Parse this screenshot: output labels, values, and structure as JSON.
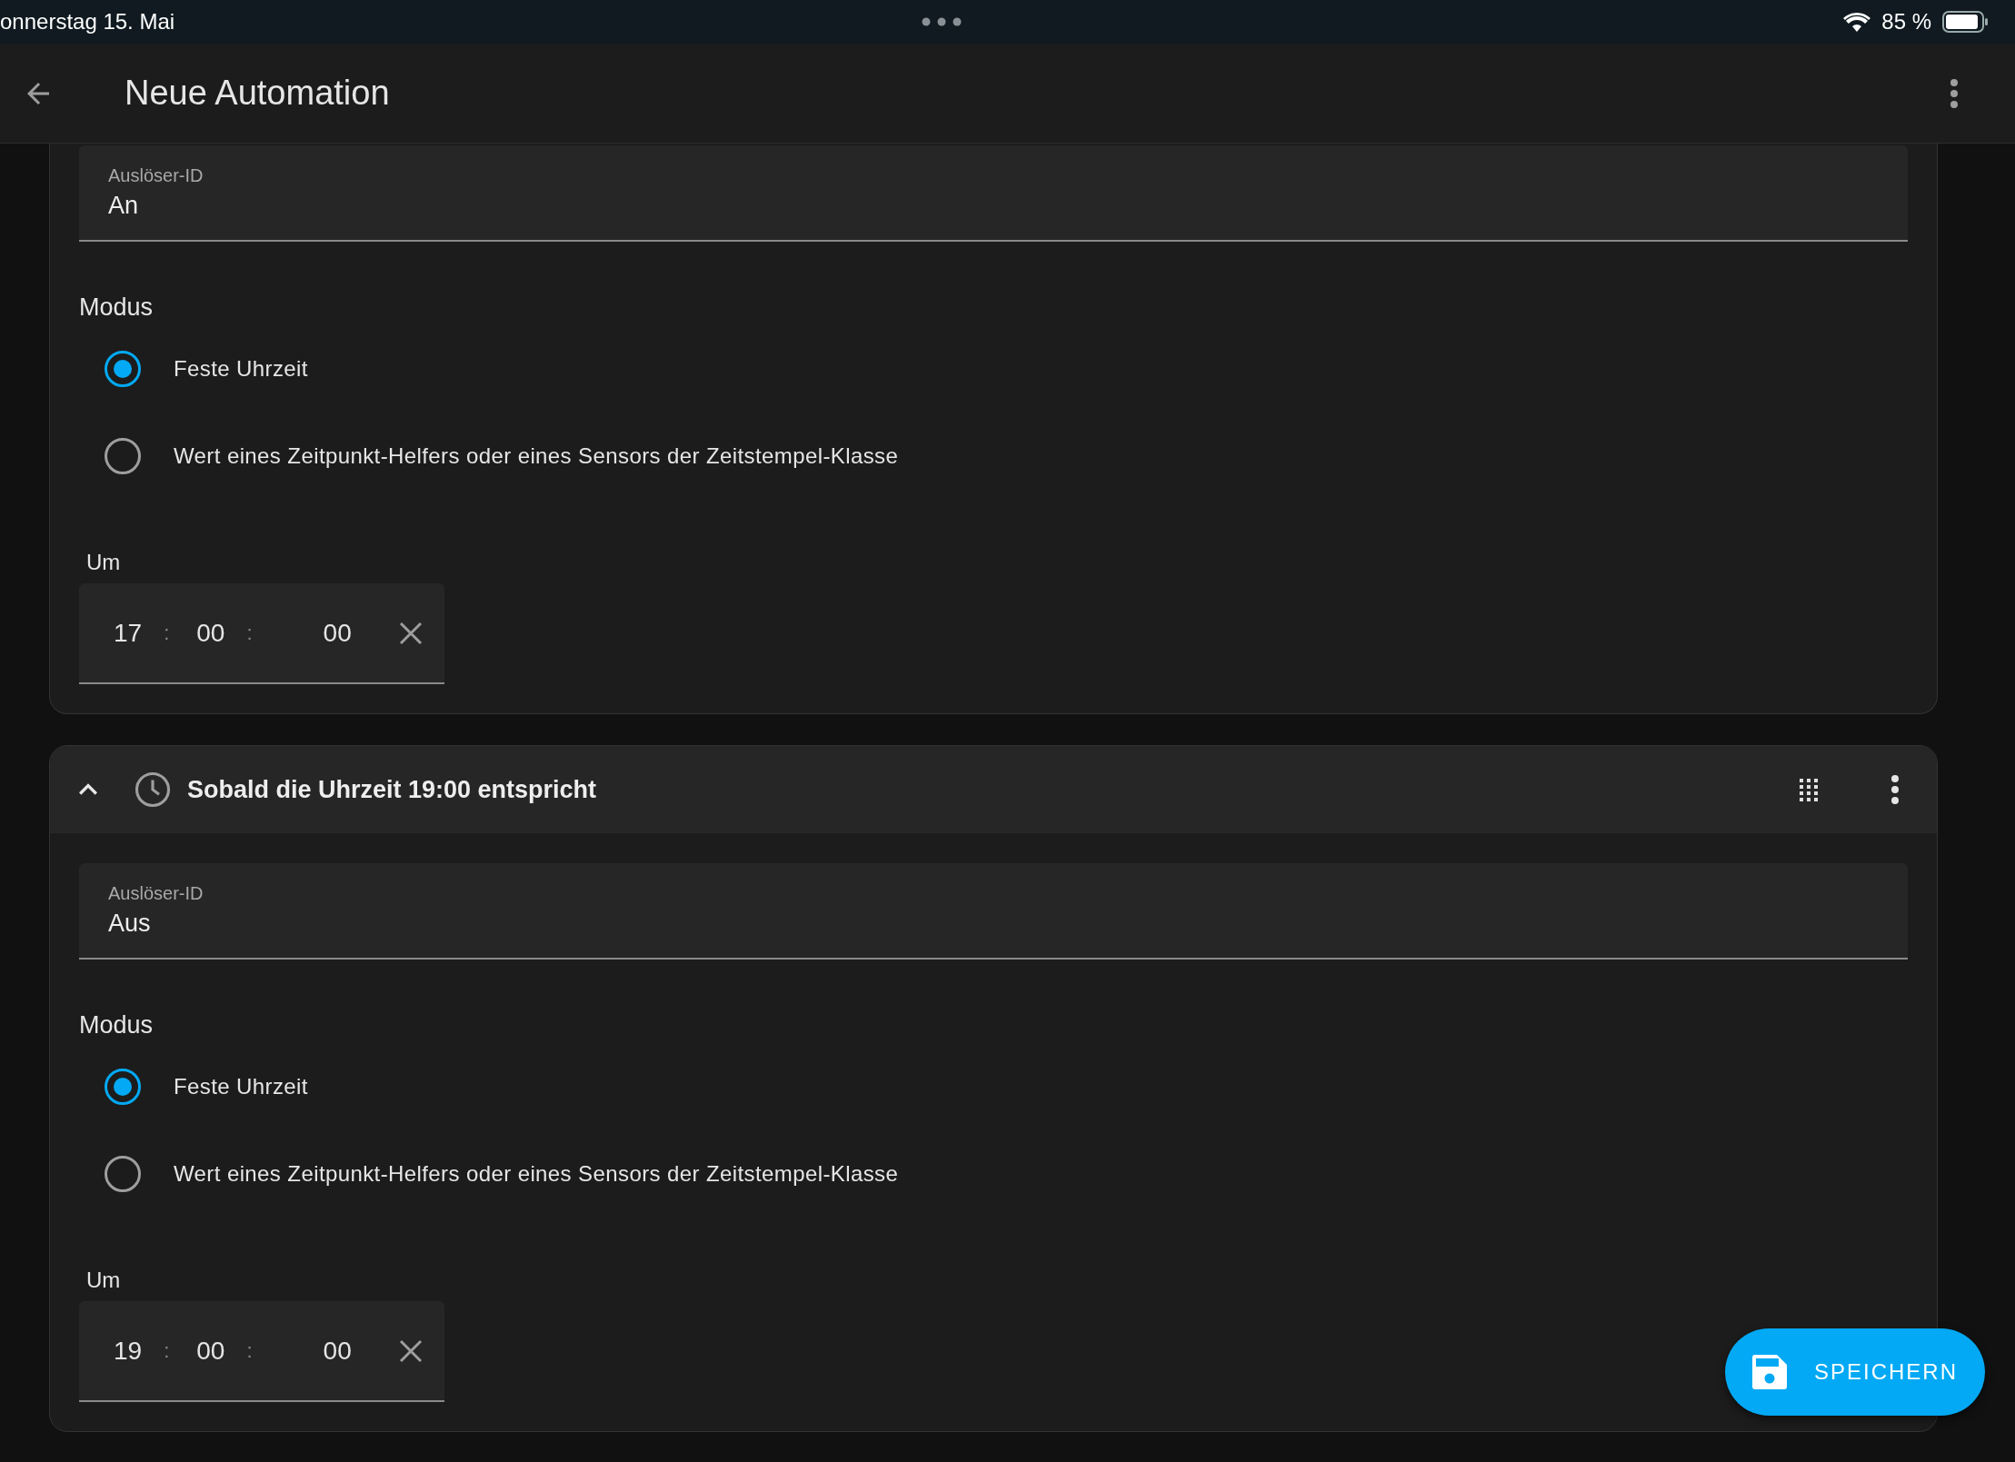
{
  "status_bar": {
    "date": "onnerstag 15. Mai",
    "battery": "85 %"
  },
  "app_bar": {
    "title": "Neue Automation"
  },
  "triggers": [
    {
      "trigger_id_label": "Auslöser-ID",
      "trigger_id": "An",
      "mode_label": "Modus",
      "options": [
        {
          "label": "Feste Uhrzeit",
          "selected": true
        },
        {
          "label": "Wert eines Zeitpunkt-Helfers oder eines Sensors der Zeitstempel-Klasse",
          "selected": false
        }
      ],
      "time_label": "Um",
      "hours": "17",
      "minutes": "00",
      "seconds": "00",
      "separators": [
        ":",
        ":"
      ]
    },
    {
      "header": {
        "title": "Sobald die Uhrzeit 19:00 entspricht",
        "expanded": true
      },
      "trigger_id_label": "Auslöser-ID",
      "trigger_id": "Aus",
      "mode_label": "Modus",
      "options": [
        {
          "label": "Feste Uhrzeit",
          "selected": true
        },
        {
          "label": "Wert eines Zeitpunkt-Helfers oder eines Sensors der Zeitstempel-Klasse",
          "selected": false
        }
      ],
      "time_label": "Um",
      "hours": "19",
      "minutes": "00",
      "seconds": "00",
      "separators": [
        ":",
        ":"
      ]
    }
  ],
  "save_button": {
    "label": "SPEICHERN"
  }
}
